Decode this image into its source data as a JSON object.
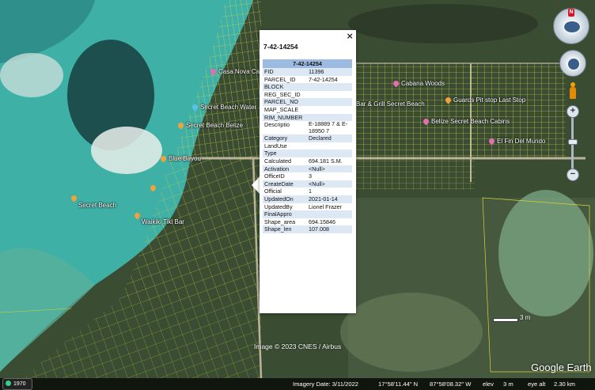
{
  "popup": {
    "title": "7-42-14254",
    "table_header": "7-42-14254",
    "close_label": "×",
    "rows": [
      {
        "k": "FID",
        "v": "11396"
      },
      {
        "k": "PARCEL_ID",
        "v": "7-42-14254"
      },
      {
        "k": "BLOCK",
        "v": ""
      },
      {
        "k": "REG_SEC_ID",
        "v": ""
      },
      {
        "k": "PARCEL_NO",
        "v": ""
      },
      {
        "k": "MAP_SCALE",
        "v": ""
      },
      {
        "k": "RIM_NUMBER",
        "v": ""
      },
      {
        "k": "Descriptio",
        "v": "E-18889 7 & E-18950 7"
      },
      {
        "k": "Category",
        "v": "Declared"
      },
      {
        "k": "LandUse",
        "v": ""
      },
      {
        "k": "Type",
        "v": ""
      },
      {
        "k": "Calculated",
        "v": "694.181 S.M."
      },
      {
        "k": "Activation",
        "v": "<Null>"
      },
      {
        "k": "OfficeID",
        "v": "3"
      },
      {
        "k": "CreateDate",
        "v": "<Null>"
      },
      {
        "k": "Official",
        "v": "1"
      },
      {
        "k": "UpdatedOn",
        "v": "2021-01-14"
      },
      {
        "k": "UpdatedBy",
        "v": "Lionel Frazer"
      },
      {
        "k": "FinalAppro",
        "v": ""
      },
      {
        "k": "Shape_area",
        "v": "694.15846"
      },
      {
        "k": "Shape_len",
        "v": "107.008"
      }
    ]
  },
  "places": [
    {
      "name": "Casa Nova Cab",
      "pin": "pink"
    },
    {
      "name": "Secret Beach Water",
      "pin": "blue"
    },
    {
      "name": "Secret Beach Belize",
      "pin": "orange"
    },
    {
      "name": "Blue Bayou",
      "pin": "orange"
    },
    {
      "name": "",
      "pin": "orange"
    },
    {
      "name": "Secret Beach",
      "pin": "orange"
    },
    {
      "name": "Waikiki Tiki Bar",
      "pin": "orange"
    },
    {
      "name": "Cabana Woods",
      "pin": "pink"
    },
    {
      "name": "Bar & Grill Secret Beach",
      "pin": ""
    },
    {
      "name": "Guards Pit stop Last Stop",
      "pin": "orange"
    },
    {
      "name": "Belize Secret Beach Cabins",
      "pin": "pink"
    },
    {
      "name": "El Fin Del Mundo",
      "pin": "pink"
    }
  ],
  "colors": {
    "parcel_lines": "#e8e04a",
    "popup_header": "#9dbbe0",
    "row_alt": "#dde8f5"
  },
  "controls": {
    "north": "N",
    "zoom_in": "+",
    "zoom_out": "−"
  },
  "attribution": "Image © 2023 CNES / Airbus",
  "logo": "Google Earth",
  "scale_label": "3 m",
  "tour_badge": "1970",
  "status": {
    "imagery_date": "Imagery Date: 3/11/2022",
    "lat": "17°58'11.44\" N",
    "lon": "87°58'08.32\" W",
    "elev_label": "elev",
    "elev_value": "3 m",
    "eye_alt": "eye alt",
    "eye_alt_value": "2.30 km"
  }
}
